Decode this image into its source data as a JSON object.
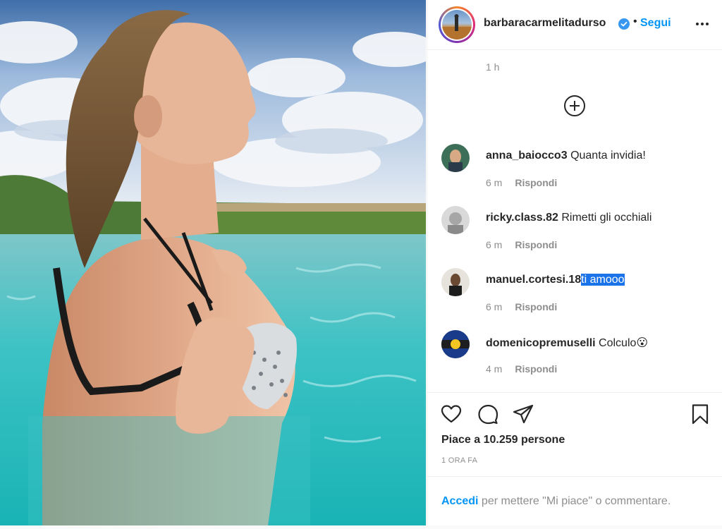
{
  "post": {
    "image_alt": "Woman in bikini standing in a turquoise pool under a cloudy blue sky"
  },
  "header": {
    "username": "barbaracarmelitadurso",
    "verified": true,
    "separator": "•",
    "follow_label": "Segui",
    "more_icon": "more-horizontal-icon"
  },
  "caption_time": "1 h",
  "load_more_icon": "plus-circle-icon",
  "comments": [
    {
      "user": "anna_baiocco3",
      "text": "Quanta invidia!",
      "time": "6 m",
      "reply": "Rispondi"
    },
    {
      "user": "ricky.class.82",
      "text": "Rimetti gli occhiali",
      "time": "6 m",
      "reply": "Rispondi"
    },
    {
      "user": "manuel.cortesi.18",
      "text": "ti amooo",
      "time": "6 m",
      "reply": "Rispondi"
    },
    {
      "user": "domenicopremuselli",
      "text": "Colculo😮",
      "time": "4 m",
      "reply": "Rispondi"
    }
  ],
  "actions": {
    "like_icon": "heart-icon",
    "comment_icon": "comment-icon",
    "share_icon": "send-icon",
    "save_icon": "bookmark-icon"
  },
  "likes_text": "Piace a 10.259 persone",
  "posted_ago": "1 ORA FA",
  "login": {
    "link": "Accedi",
    "rest": "per mettere \"Mi piace\" o commentare."
  },
  "colors": {
    "accent": "#0095f6",
    "text": "#262626",
    "muted": "#8e8e8e",
    "selection": "#1a73e8"
  }
}
